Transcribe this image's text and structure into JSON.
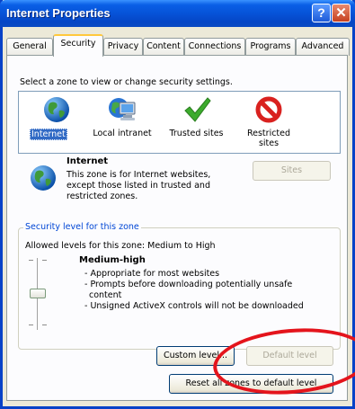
{
  "window": {
    "title": "Internet Properties",
    "help_glyph": "?",
    "close_glyph": "✕"
  },
  "tabs": [
    "General",
    "Security",
    "Privacy",
    "Content",
    "Connections",
    "Programs",
    "Advanced"
  ],
  "active_tab": "Security",
  "zones": {
    "prompt": "Select a zone to view or change security settings.",
    "items": [
      {
        "label": "Internet",
        "selected": true,
        "icon": "globe-icon"
      },
      {
        "label": "Local intranet",
        "selected": false,
        "icon": "intranet-icon"
      },
      {
        "label": "Trusted sites",
        "selected": false,
        "icon": "checkmark-icon"
      },
      {
        "label": "Restricted sites",
        "selected": false,
        "icon": "restricted-icon"
      }
    ]
  },
  "zone_detail": {
    "title": "Internet",
    "description_lines": [
      "This zone is for Internet websites,",
      "except those listed in trusted and",
      "restricted zones."
    ],
    "sites_button": "Sites"
  },
  "security_level": {
    "legend": "Security level for this zone",
    "allowed": "Allowed levels for this zone: Medium to High",
    "level": "Medium-high",
    "details": [
      "- Appropriate for most websites",
      "- Prompts before downloading potentially unsafe",
      "content",
      "- Unsigned ActiveX controls will not be downloaded"
    ]
  },
  "buttons": {
    "custom_level": "Custom level...",
    "default_level": "Default level",
    "reset_all": "Reset all zones to default level"
  },
  "colors": {
    "title_bar": "#0653d8",
    "annotation": "#e4141c",
    "selection": "#316ac5"
  }
}
